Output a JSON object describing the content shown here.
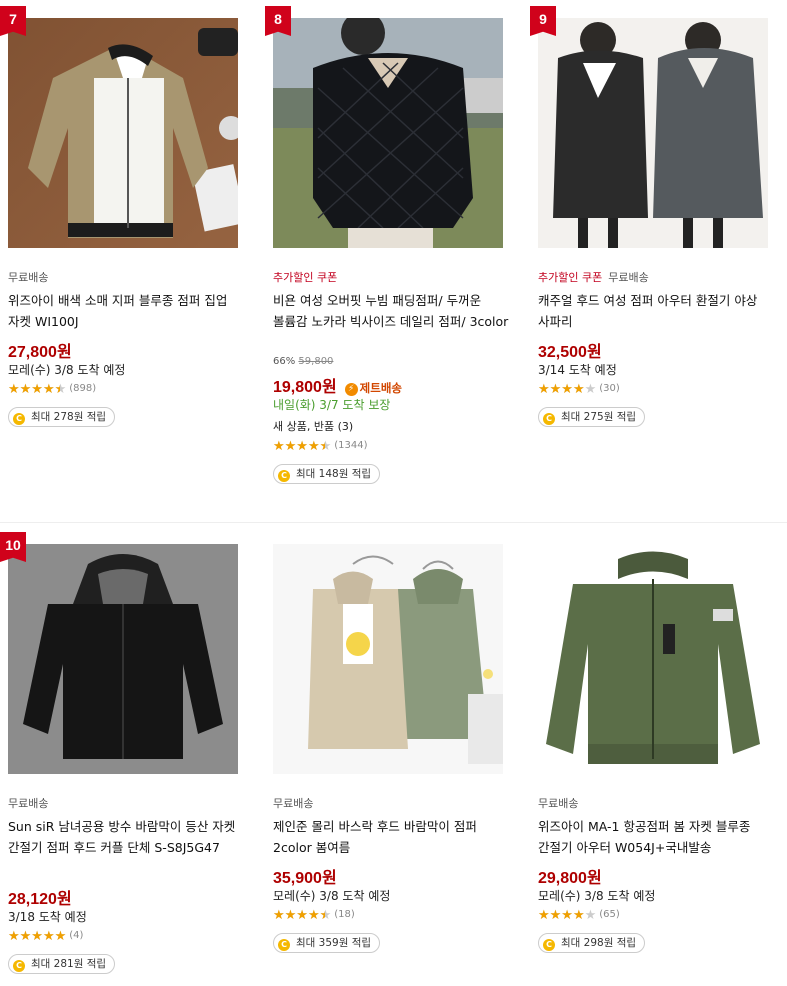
{
  "products": [
    {
      "rank": "7",
      "image": "khaki-bomber-jacket",
      "badges": [
        {
          "text": "무료배송",
          "type": "free"
        }
      ],
      "title": "위즈아이 배색 소매 지퍼 블루종 점퍼 집업 자켓 WI100J",
      "price": "27,800원",
      "delivery": "모레(수) 3/8 도착 예정",
      "rating": 4.5,
      "reviews": "(898)",
      "points": "최대 278원 적립"
    },
    {
      "rank": "8",
      "image": "black-quilted-padding-jacket",
      "badges": [
        {
          "text": "추가할인 쿠폰",
          "type": "coupon"
        }
      ],
      "title": "비욘 여성 오버핏 누빔 패딩점퍼/ 두꺼운 볼륨감 노카라 빅사이즈 데일리 점퍼/ 3color",
      "discount": {
        "rate": "66%",
        "original": "59,800"
      },
      "price": "19,800원",
      "jet_label": "제트배송",
      "delivery": "내일(화) 3/7 도착 보장",
      "delivery_color": "green",
      "extra": "새 상품, 반품 (3)",
      "rating": 4.5,
      "reviews": "(1344)",
      "points": "최대 148원 적립"
    },
    {
      "rank": "9",
      "image": "hooded-safari-coat",
      "badges": [
        {
          "text": "추가할인 쿠폰",
          "type": "coupon"
        },
        {
          "text": "무료배송",
          "type": "free"
        }
      ],
      "title": "캐주얼 후드 여성 점퍼 아우터 환절기 야상 사파리",
      "price": "32,500원",
      "delivery": "3/14 도착 예정",
      "rating": 4,
      "reviews": "(30)",
      "points": "최대 275원 적립"
    },
    {
      "rank": "10",
      "image": "black-windbreaker",
      "badges": [
        {
          "text": "무료배송",
          "type": "free"
        }
      ],
      "title": "Sun siR 남녀공용 방수 바람막이 등산 자켓 간절기 점퍼 후드 커플 단체 S-S8J5G47",
      "price": "28,120원",
      "delivery": "3/18 도착 예정",
      "rating": 5,
      "reviews": "(4)",
      "points": "최대 281원 적립"
    },
    {
      "rank": "",
      "image": "beige-green-hooded-windbreakers",
      "badges": [
        {
          "text": "무료배송",
          "type": "free"
        }
      ],
      "title": "제인준 몰리 바스락 후드 바람막이 점퍼 2color 봄여름",
      "price": "35,900원",
      "delivery": "모레(수) 3/8 도착 예정",
      "rating": 4.5,
      "reviews": "(18)",
      "points": "최대 359원 적립"
    },
    {
      "rank": "",
      "image": "green-ma1-flight-jacket",
      "badges": [
        {
          "text": "무료배송",
          "type": "free"
        }
      ],
      "title": "위즈아이 MA-1 항공점퍼 봄 자켓 블루종 간절기 아우터 W054J+국내발송",
      "price": "29,800원",
      "delivery": "모레(수) 3/8 도착 예정",
      "rating": 4,
      "reviews": "(65)",
      "points": "최대 298원 적립"
    }
  ],
  "coin_glyph": "C",
  "jet_glyph": "⚡",
  "colors": {
    "price": "#ae0000",
    "coupon": "#c2001e",
    "delivery_green": "#4a9d2e",
    "star": "#f0a000"
  }
}
